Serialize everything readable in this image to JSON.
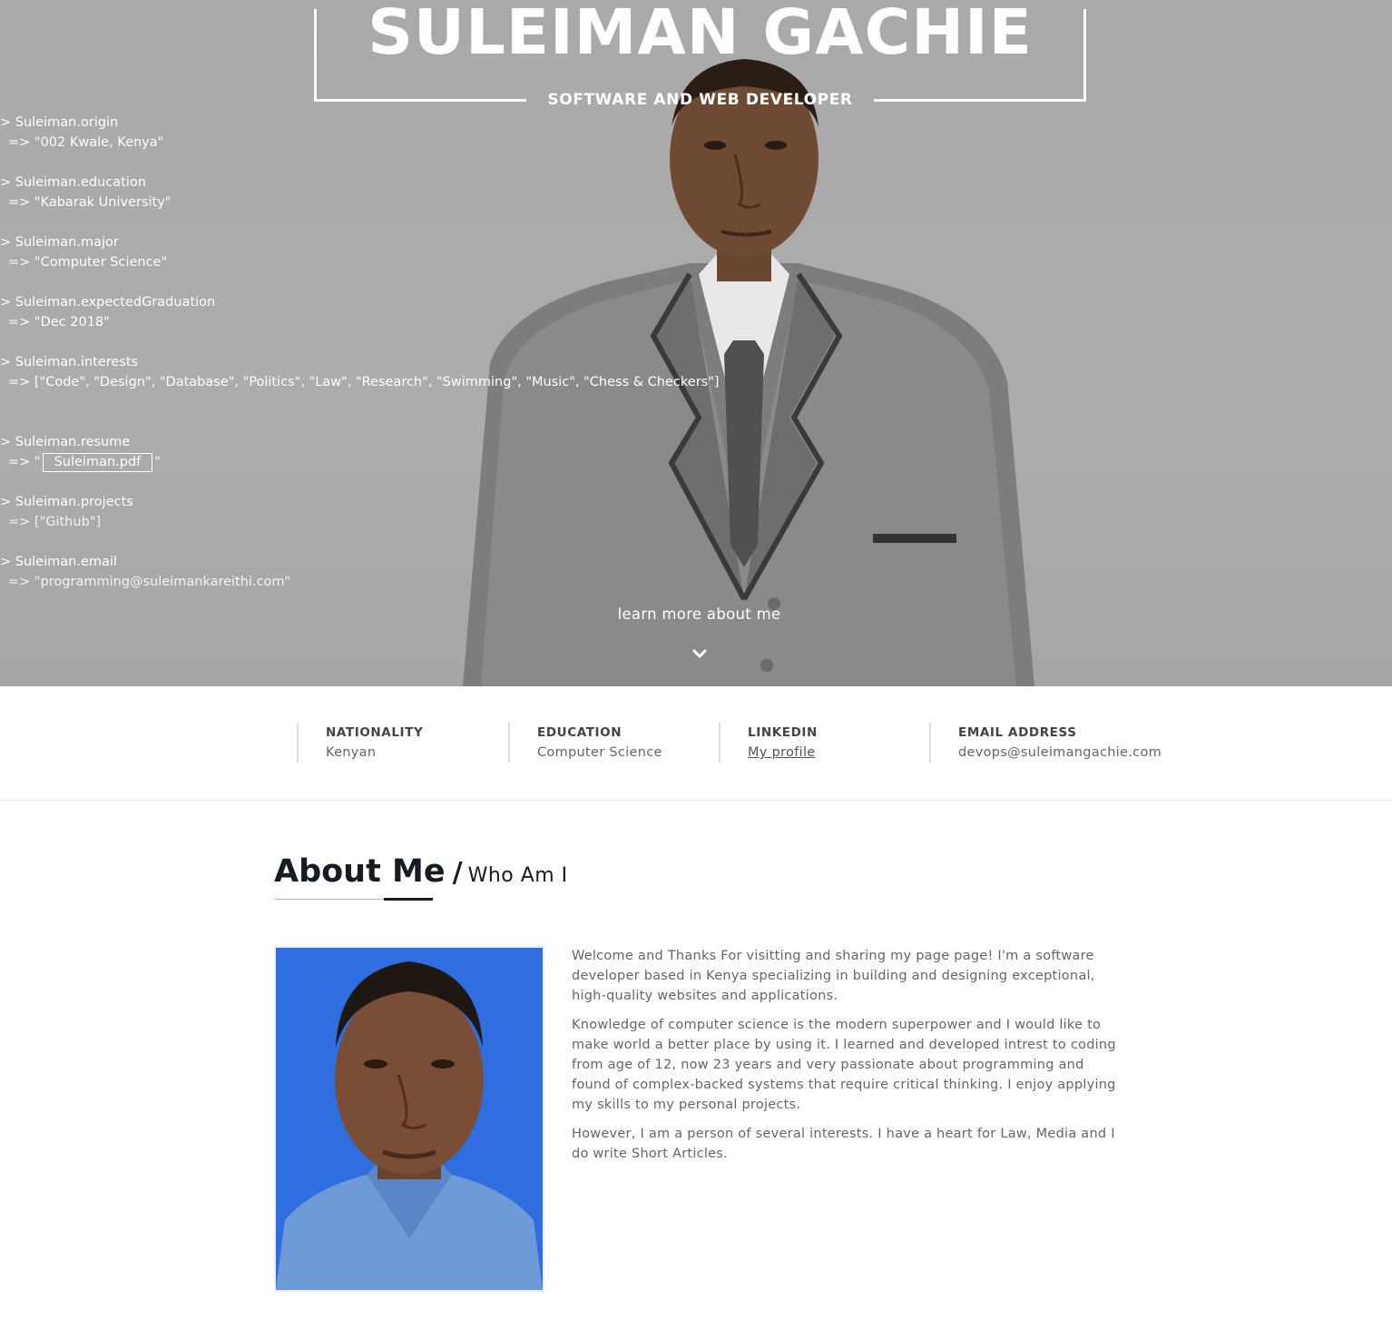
{
  "hero": {
    "name": "SULEIMAN GACHIE",
    "role": "SOFTWARE AND WEB DEVELOPER",
    "learn_more": "learn more about me"
  },
  "console": {
    "origin_cmd": "> Suleiman.origin",
    "origin_res": "=> \"002 Kwale, Kenya\"",
    "education_cmd": "> Suleiman.education",
    "education_res": "=> \"Kabarak University\"",
    "major_cmd": "> Suleiman.major",
    "major_res": "=> \"Computer Science\"",
    "graduation_cmd": "> Suleiman.expectedGraduation",
    "graduation_res": "=> \"Dec 2018\"",
    "interests_cmd": "> Suleiman.interests",
    "interests_res": "=> [\"Code\", \"Design\", \"Database\", \"Politics\", \"Law\", \"Research\", \"Swimming\", \"Music\", \"Chess & Checkers\"]",
    "resume_cmd": "> Suleiman.resume",
    "resume_prefix": "=> \"",
    "resume_link": "Suleiman.pdf",
    "resume_suffix": "\"",
    "projects_cmd": "> Suleiman.projects",
    "projects_res": "=> [\"Github\"]",
    "email_cmd": "> Suleiman.email",
    "email_res": "=> \"programming@suleimankareithi.com\""
  },
  "info": {
    "nationality_label": "NATIONALITY",
    "nationality_value": "Kenyan",
    "education_label": "EDUCATION",
    "education_value": "Computer Science",
    "linkedin_label": "LINKEDIN",
    "linkedin_value": "My profile",
    "email_label": "EMAIL ADDRESS",
    "email_value": "devops@suleimangachie.com"
  },
  "about": {
    "title": "About Me",
    "slash": "/",
    "subtitle": "Who Am I",
    "p1": "Welcome and Thanks For visitting and sharing my page page! I'm a software developer based in Kenya specializing in building and designing exceptional, high-quality websites and applications.",
    "p2": "Knowledge of computer science is the modern superpower and I would like to make world a better place by using it. I learned and developed intrest to coding from age of 12, now 23 years and very passionate about programming and found of complex-backed systems that require critical thinking. I enjoy applying my skills to my personal projects.",
    "p3": "However, I am a person of several interests. I have a heart for Law, Media and I do write Short Articles."
  },
  "colors": {
    "hero_bg": "#aaaaaa",
    "heading_dark": "#161b24",
    "photo_bg": "#2f6ee0"
  },
  "icons": {
    "scroll_down": "chevron-down-icon"
  }
}
